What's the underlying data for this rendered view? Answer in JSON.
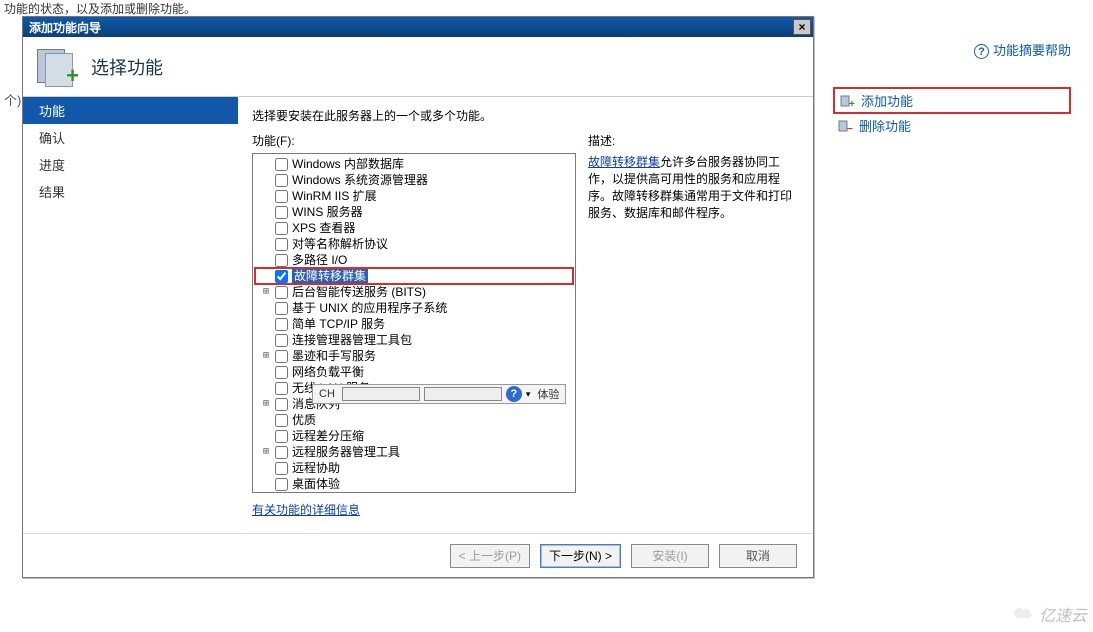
{
  "top_hint": "功能的状态，以及添加或删除功能。",
  "left_stub": "个)",
  "right": {
    "help": "功能摘要帮助",
    "add": "添加功能",
    "remove": "删除功能"
  },
  "wizard": {
    "title": "添加功能向导",
    "banner_title": "选择功能",
    "nav": {
      "items": [
        "功能",
        "确认",
        "进度",
        "结果"
      ],
      "current_index": 0
    },
    "instruction": "选择要安装在此服务器上的一个或多个功能。",
    "features_label": "功能(F):",
    "desc_label": "描述:",
    "desc_link": "故障转移群集",
    "desc_text": "允许多台服务器协同工作，以提供高可用性的服务和应用程序。故障转移群集通常用于文件和打印服务、数据库和邮件程序。",
    "detail_link": "有关功能的详细信息",
    "ime": {
      "label": "CH",
      "trail": "体验"
    },
    "features": [
      {
        "label": "Windows 内部数据库",
        "checked": false,
        "exp": ""
      },
      {
        "label": "Windows 系统资源管理器",
        "checked": false,
        "exp": ""
      },
      {
        "label": "WinRM IIS 扩展",
        "checked": false,
        "exp": ""
      },
      {
        "label": "WINS 服务器",
        "checked": false,
        "exp": ""
      },
      {
        "label": "XPS 查看器",
        "checked": false,
        "exp": ""
      },
      {
        "label": "对等名称解析协议",
        "checked": false,
        "exp": ""
      },
      {
        "label": "多路径 I/O",
        "checked": false,
        "exp": ""
      },
      {
        "label": "故障转移群集",
        "checked": true,
        "exp": "",
        "selected": true,
        "highlight": true
      },
      {
        "label": "后台智能传送服务 (BITS)",
        "checked": false,
        "exp": "+"
      },
      {
        "label": "基于 UNIX 的应用程序子系统",
        "checked": false,
        "exp": ""
      },
      {
        "label": "简单 TCP/IP 服务",
        "checked": false,
        "exp": ""
      },
      {
        "label": "连接管理器管理工具包",
        "checked": false,
        "exp": ""
      },
      {
        "label": "墨迹和手写服务",
        "checked": false,
        "exp": "+"
      },
      {
        "label": "网络负载平衡",
        "checked": false,
        "exp": ""
      },
      {
        "label": "无线 LAN 服务",
        "checked": false,
        "exp": ""
      },
      {
        "label": "消息队列",
        "checked": false,
        "exp": "+"
      },
      {
        "label": "优质",
        "checked": false,
        "exp": "",
        "ime_overlap": true
      },
      {
        "label": "远程差分压缩",
        "checked": false,
        "exp": ""
      },
      {
        "label": "远程服务器管理工具",
        "checked": false,
        "exp": "+"
      },
      {
        "label": "远程协助",
        "checked": false,
        "exp": ""
      },
      {
        "label": "桌面体验",
        "checked": false,
        "exp": ""
      }
    ],
    "buttons": {
      "prev": "< 上一步(P)",
      "next": "下一步(N) >",
      "install": "安装(I)",
      "cancel": "取消"
    }
  },
  "watermark": "亿速云"
}
